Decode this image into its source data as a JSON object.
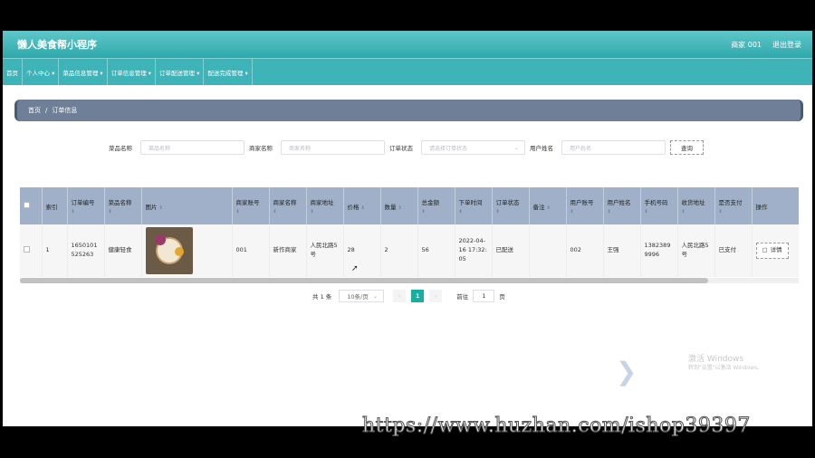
{
  "app": {
    "title": "懒人美食帮小程序",
    "user": "商家 001",
    "logout": "退出登录"
  },
  "nav": [
    "首页",
    "个人中心 ▾",
    "菜品信息管理 ▾",
    "订单信息管理 ▾",
    "订单配送管理 ▾",
    "配送完成管理 ▾"
  ],
  "breadcrumb": {
    "home": "首页",
    "sep": "/",
    "current": "订单信息"
  },
  "filters": {
    "dish_label": "菜品名称",
    "dish_placeholder": "菜品名称",
    "merchant_label": "商家名称",
    "merchant_placeholder": "商家名称",
    "status_label": "订单状态",
    "status_placeholder": "请选择订单状态",
    "user_label": "用户姓名",
    "user_placeholder": "用户姓名",
    "search": "查询"
  },
  "table": {
    "headers": [
      "索引",
      "订单编号",
      "菜品名称",
      "图片",
      "商家账号",
      "商家名称",
      "商家地址",
      "价格",
      "数量",
      "总金额",
      "下单时间",
      "订单状态",
      "备注",
      "用户账号",
      "用户姓名",
      "手机号码",
      "收货地址",
      "是否支付",
      "操作"
    ],
    "sort_glyph": "⇕",
    "rows": [
      {
        "index": "1",
        "order_no": "1650101525263",
        "dish": "健康轻食",
        "merchant_acct": "001",
        "merchant_name": "新作商家",
        "address": "人民北路5号",
        "price": "28",
        "qty": "2",
        "total": "56",
        "time": "2022-04-16 17:32:05",
        "status": "已配送",
        "remark": "",
        "user_acct": "002",
        "user_name": "王强",
        "phone": "13823899996",
        "delivery_addr": "人民北路5号",
        "paid": "已支付",
        "action": "详情"
      }
    ]
  },
  "pager": {
    "total": "共 1 条",
    "size": "10条/页",
    "prev": "‹",
    "page": "1",
    "next": "›",
    "goto": "前往",
    "goto_val": "1",
    "unit": "页"
  },
  "watermark": {
    "line1": "激活 Windows",
    "line2": "转到\"设置\"以激活 Windows。"
  },
  "overlay_url": "https://www.huzhan.com/ishop39397"
}
